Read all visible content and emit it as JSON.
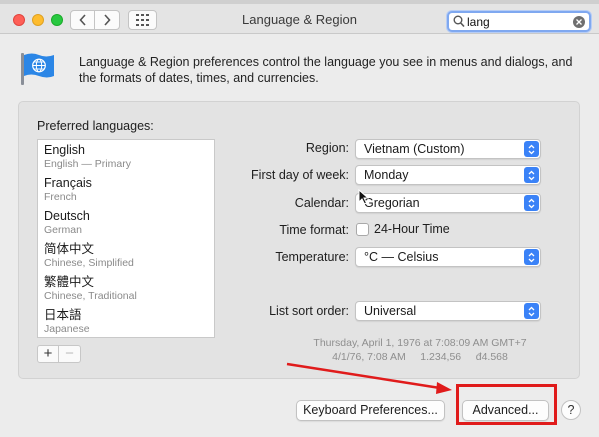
{
  "window": {
    "title": "Language & Region",
    "search_value": "lang"
  },
  "intro_text": "Language & Region preferences control the language you see in menus and dialogs, and the formats of dates, times, and currencies.",
  "preferred_languages": {
    "label": "Preferred languages:",
    "items": [
      {
        "name": "English",
        "sub": "English — Primary"
      },
      {
        "name": "Français",
        "sub": "French"
      },
      {
        "name": "Deutsch",
        "sub": "German"
      },
      {
        "name": "简体中文",
        "sub": "Chinese, Simplified"
      },
      {
        "name": "繁體中文",
        "sub": "Chinese, Traditional"
      },
      {
        "name": "日本語",
        "sub": "Japanese"
      }
    ],
    "add_label": "+",
    "remove_label": "−"
  },
  "settings": {
    "region_label": "Region:",
    "region_value": "Vietnam (Custom)",
    "first_day_label": "First day of week:",
    "first_day_value": "Monday",
    "calendar_label": "Calendar:",
    "calendar_value": "Gregorian",
    "time_format_label": "Time format:",
    "time_format_option": "24-Hour Time",
    "temperature_label": "Temperature:",
    "temperature_value": "°C — Celsius",
    "sort_label": "List sort order:",
    "sort_value": "Universal"
  },
  "sample": {
    "line1": "Thursday, April 1, 1976 at 7:08:09 AM GMT+7",
    "line2": "4/1/76, 7:08 AM     1.234,56     đ4.568"
  },
  "buttons": {
    "keyboard": "Keyboard Preferences...",
    "advanced": "Advanced...",
    "help": "?"
  },
  "colors": {
    "accent": "#3a82f7",
    "annotation": "#e01b1b"
  }
}
